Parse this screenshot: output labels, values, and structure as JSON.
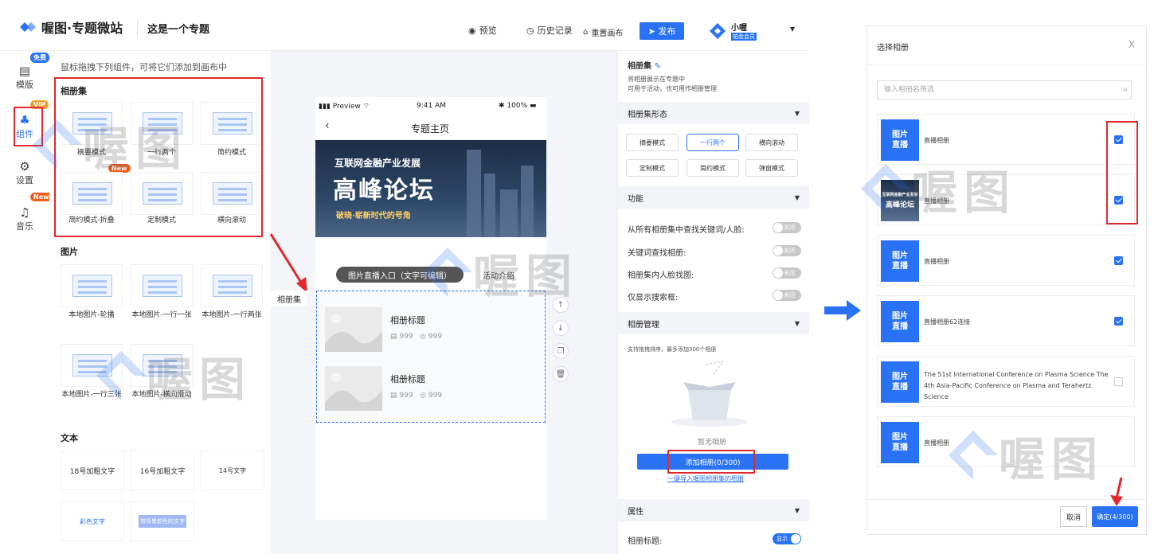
{
  "header": {
    "logo": "喔图·专题微站",
    "page_name": "这是一个专题",
    "preview": "预览",
    "history": "历史记录",
    "reset": "重置画布",
    "publish": "发布",
    "user_name": "小喔",
    "user_badge": "铂金会员"
  },
  "nav": {
    "items": [
      {
        "label": "模版",
        "icon": "template-icon"
      },
      {
        "label": "组件",
        "icon": "component-icon"
      },
      {
        "label": "设置",
        "icon": "settings-icon"
      },
      {
        "label": "音乐",
        "icon": "music-icon"
      }
    ],
    "tag_free": "免费",
    "tag_vip": "VIP",
    "tag_new": "New"
  },
  "components": {
    "hint": "鼠标拖拽下列组件，可将它们添加到画布中",
    "sec_album": "相册集",
    "album_tiles": [
      "摘要模式",
      "一行两个",
      "简约模式",
      "简约模式-折叠",
      "定制模式",
      "横向滚动"
    ],
    "sec_image": "图片",
    "image_tiles": [
      "本地图片-轮播",
      "本地图片-一行一张",
      "本地图片-一行两张",
      "本地图片-一行三张",
      "本地图片-横向滑动"
    ],
    "sec_text": "文本",
    "text_tiles": [
      "18号加粗文字",
      "16号加粗文字",
      "14号文字",
      "彩色文字",
      "带背景颜色的文字"
    ]
  },
  "phone": {
    "carrier": "Preview",
    "time": "9:41 AM",
    "battery": "100%",
    "title": "专题主页",
    "banner_line1": "互联网金融产业发展",
    "banner_line2": "高峰论坛",
    "banner_line3": "破晓·崭新时代的号角",
    "tab1": "图片直播入口（文字可编辑）",
    "tab2": "活动介绍",
    "albums": [
      {
        "title": "相册标题",
        "photos": "999",
        "views": "999"
      },
      {
        "title": "相册标题",
        "photos": "999",
        "views": "999"
      }
    ],
    "float_label": "相册集"
  },
  "props": {
    "title": "相册集",
    "desc1": "将相册展示在专题中",
    "desc2": "可用于活动，也可用作相册管理",
    "sec_form": "相册集形态",
    "modes": [
      "摘要模式",
      "一行两个",
      "横向滚动",
      "定制模式",
      "简约模式",
      "弹窗模式"
    ],
    "sec_func": "功能",
    "toggles": [
      "从所有相册集中查找关键词/人脸:",
      "关键词查找相册:",
      "相册集内人脸找图:",
      "仅显示搜索框:"
    ],
    "toggle_off": "关闭",
    "sec_manage": "相册管理",
    "manage_hint": "支持拖拽排序，最多添加300个相册",
    "empty": "暂无相册",
    "add_btn": "添加相册(0/300)",
    "import_link": "一键导入喔图相册集的相册",
    "sec_attr": "属性",
    "attr_title": "相册标题:",
    "toggle_on": "显示"
  },
  "dialog": {
    "title": "选择相册",
    "close": "X",
    "search_placeholder": "输入相册名筛选",
    "cover_text1": "图片",
    "cover_text2": "直播",
    "items": [
      {
        "name": "直播相册",
        "checked": true
      },
      {
        "name": "直播相册",
        "checked": true,
        "banner": "高峰论坛",
        "banner_small": "互联网金融产业发展"
      },
      {
        "name": "直播相册",
        "checked": true
      },
      {
        "name": "直播相册62连接",
        "checked": true
      },
      {
        "name": "The 51st International Conference on Plasma Science The 4th Asia-Pacific Conference on Plasma and Terahertz Science",
        "checked": false
      },
      {
        "name": "直播相册",
        "checked": false
      }
    ],
    "cancel": "取消",
    "confirm": "确定(4/300)"
  },
  "watermark": "喔图",
  "colors": {
    "accent": "#2a72f5",
    "highlight": "#e0282e"
  }
}
